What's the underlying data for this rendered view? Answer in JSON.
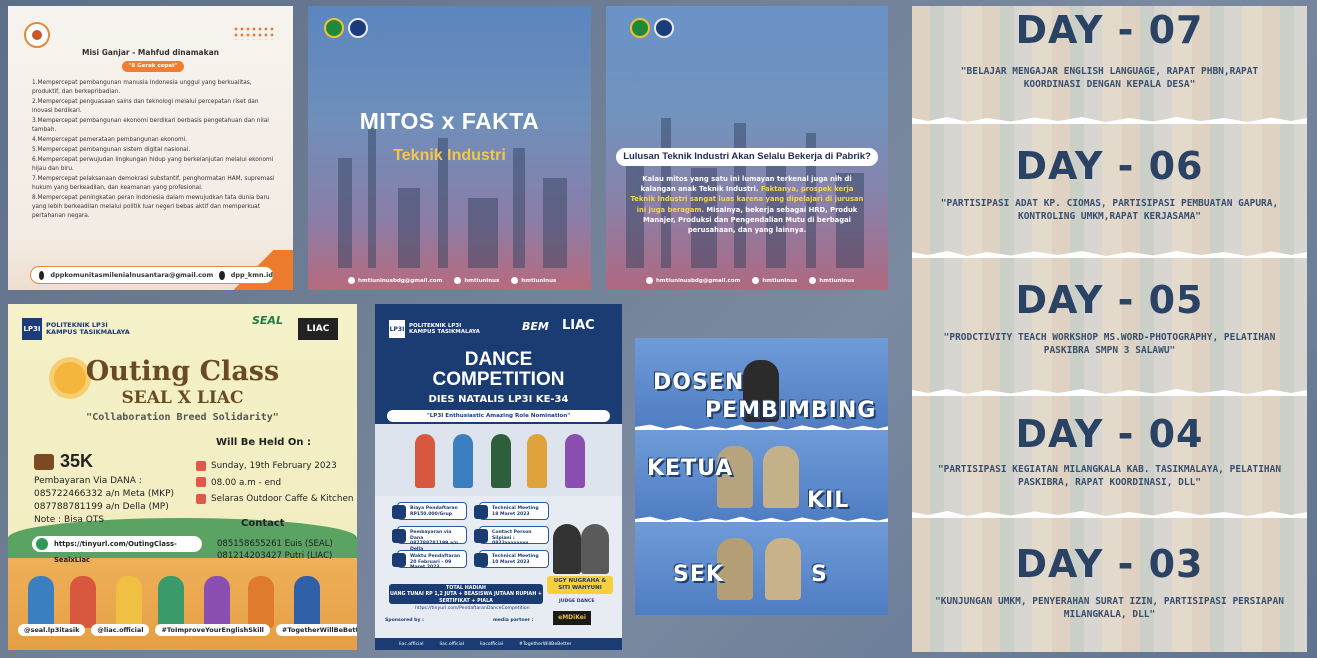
{
  "misi": {
    "title": "Misi Ganjar - Mahfud dinamakan",
    "pill": "\"8 Gerak cepat\"",
    "items": [
      "1.Mempercepat pembangunan manusia Indonesia unggul yang berkualitas, produktif, dan berkepribadian.",
      "2.Mempercepat penguasaan sains dan teknologi melalui percepatan riset dan inovasi berdikari.",
      "3.Mempercepat pembangunan ekonomi berdikari berbasis pengetahuan dan nilai tambah.",
      "4.Mempercepat pemerataan pembangunan ekonomi.",
      "5.Mempercepat pembangunan sistem digital nasional.",
      "6.Mempercepat perwujudan lingkungan hidup yang berkelanjutan melalui ekonomi hijau dan biru.",
      "7.Mempercepat pelaksanaan demokrasi substantif, penghormatan HAM, supremasi hukum yang berkeadilan, dan keamanan yang profesional.",
      "8.Mempercepat peningkatan peran Indonesia dalam mewujudkan tata dunia baru yang lebih berkeadilan melalui politik luar negeri bebas aktif dan memperkuat pertahanan negara."
    ],
    "email": "dppkomunitasmilenialnusantara@gmail.com",
    "ig": "dpp_kmn.id"
  },
  "mitos": {
    "title": "MITOS x FAKTA",
    "subtitle": "Teknik Industri",
    "footer": [
      "hmtiuninusbdg@gmail.com",
      "hmtiuninus",
      "hmtiuninus"
    ]
  },
  "lulusan": {
    "question": "Lulusan Teknik Industri Akan Selalu Bekerja di Pabrik?",
    "para_a": "Kalau mitos yang satu ini lumayan terkenal juga nih di kalangan anak Teknik Industri. ",
    "para_hl": "Faktanya, prospek kerja Teknik Industri sangat luas karena yang dipelajari di jurusan ini juga beragam.",
    "para_b": " Misalnya, bekerja sebagai HRD, Produk Manajer, Produksi dan Pengendalian Mutu di berbagai perusahaan, dan yang lainnya.",
    "footer": [
      "hmtiuninusbdg@gmail.com",
      "hmtiuninus",
      "hmtiuninus"
    ]
  },
  "days": [
    {
      "title": "DAY - 07",
      "desc": "\"BELAJAR MENGAJAR ENGLISH LANGUAGE, RAPAT PHBN,RAPAT KOORDINASI DENGAN KEPALA DESA\""
    },
    {
      "title": "DAY - 06",
      "desc": "\"PARTISIPASI ADAT KP. CIOMAS, PARTISIPASI PEMBUATAN GAPURA, KONTROLING UMKM,RAPAT KERJASAMA\""
    },
    {
      "title": "DAY - 05",
      "desc": "\"PRODCTIVITY TEACH WORKSHOP MS.WORD-PHOTOGRAPHY, PELATIHAN PASKIBRA SMPN 3 SALAWU\""
    },
    {
      "title": "DAY - 04",
      "desc": "\"PARTISIPASI KEGIATAN MILANGKALA KAB. TASIKMALAYA, PELATIHAN PASKIBRA, RAPAT KOORDINASI, DLL\""
    },
    {
      "title": "DAY - 03",
      "desc": "\"KUNJUNGAN UMKM, PENYERAHAN SURAT IZIN, PARTISIPASI PERSIAPAN MILANGKALA, DLL\""
    }
  ],
  "outing": {
    "brand_line1": "POLITEKNIK LP3I",
    "brand_line2": "KAMPUS TASIKMALAYA",
    "lp3i": "LP3I",
    "seal": "SEAL",
    "liac": "LIAC",
    "title": "Outing Class",
    "subtitle": "SEAL X LIAC",
    "tagline": "\"Collaboration Breed Solidarity\"",
    "held_on": "Will Be Held On :",
    "price": "35K",
    "pay_title": "Pembayaran Via DANA :",
    "pay_1": "085722466332  a/n Meta (MKP)",
    "pay_2": "087788781199   a/n Della (MP)",
    "note": "Note : Bisa OTS",
    "date": "Sunday, 19th February 2023",
    "time": "08.00 a.m - end",
    "place": "Selaras Outdoor Caffe & Kitchen",
    "contact_title": "Contact",
    "contact_1": "085158655261 Euis  (SEAL)",
    "contact_2": "081214203427  Putri (LIAC)",
    "link": "https://tinyurl.com/OutingClass-SealxLiac",
    "socials": [
      "@seal.lp3itasik",
      "@liac.official",
      "#ToImproveYourEnglishSkill",
      "#TogetherWillBeBetter"
    ]
  },
  "dance": {
    "brand_line1": "POLITEKNIK LP3I",
    "brand_line2": "KAMPUS TASIKMALAYA",
    "lp3i": "LP3I",
    "bem": "BEM",
    "liac": "LIAC",
    "title1": "DANCE",
    "title2": "COMPETITION",
    "dies": "DIES NATALIS LP3I KE-34",
    "theme": "\"LP3I Enthusiastic Amazing Role Nomination\"",
    "boxes": [
      "Biaya Pendaftaran\nRP150.000/Grup",
      "Technical Meeting\n18 Maret 2023",
      "Pembayaran via Dana\n087788781199 a/n Della",
      "Contact Person\nSilpiani : 0822xxxxxxxx",
      "Waktu Pendaftaran\n20 Februari - 09 Maret 2023",
      "Technical Meeting\n10 Maret 2023"
    ],
    "judge": "UGY NUGRAHA & SITI WAHYUNI",
    "judge_role": "JUDGE DANCE",
    "prize_title": "TOTAL HADIAH",
    "prize": "UANG TUNAI RP 1,2 JUTA + BEASISWA JUTAAN RUPIAH + SERTIFIKAT + PIALA",
    "url": "https://tinyurl.com/PendaftaranDanceCompetition",
    "sponsor": "Sponsored by :",
    "media": "media partner :",
    "emdi": "eMDiKei",
    "footer": [
      "liac.official",
      "liac.official",
      "liacofficial",
      "#TogetherWillBeBetter"
    ]
  },
  "dosen": {
    "words": [
      "DOSEN",
      "PEMBIMBING",
      "KETUA",
      "KIL",
      "SEK",
      "S"
    ]
  },
  "colors": {
    "mitos_title": "#ffffff",
    "mitos_sub": "#f3c84a",
    "day_title": "#2a4263",
    "dance_bg": "#1b3c73",
    "outing_accent": "#6a4a23"
  }
}
